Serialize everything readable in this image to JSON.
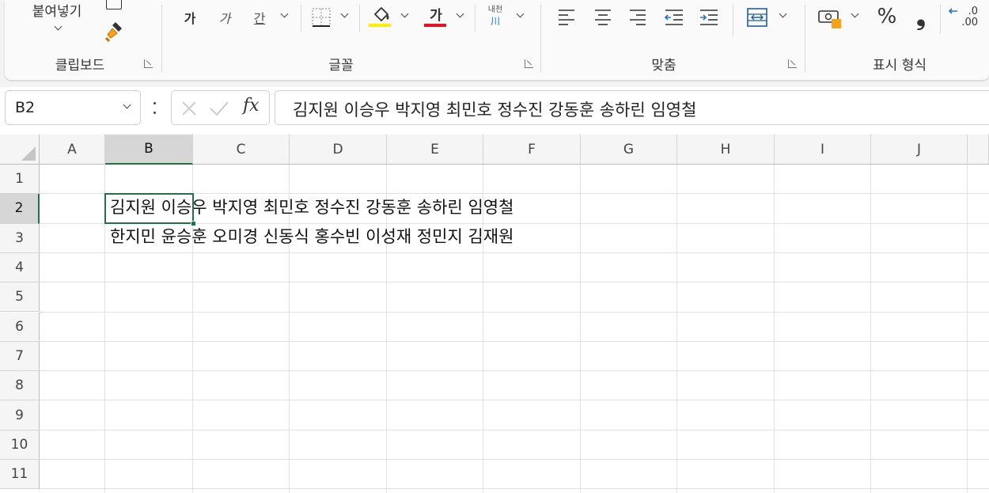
{
  "ribbon": {
    "clipboard": {
      "paste_label": "붙여넣기",
      "copy_label": "복사",
      "group_label": "클립보드"
    },
    "font": {
      "bold_label": "가",
      "italic_label": "가",
      "underline_label": "간",
      "font_color_label": "가",
      "phonetic_label": "내천",
      "fill_color": "#ffee00",
      "font_color": "#e81123",
      "group_label": "글꼴"
    },
    "alignment": {
      "group_label": "맞춤"
    },
    "number": {
      "percent_label": "%",
      "comma_label": "❟",
      "increase_decimal_label": ".0",
      "increase_decimal_label2": ".00",
      "group_label": "표시 형식"
    }
  },
  "formula_bar": {
    "name_box": "B2",
    "fx_label": "fx",
    "content": "김지원 이승우 박지영 최민호 정수진 강동훈 송하린 임영철"
  },
  "sheet": {
    "columns": [
      "A",
      "B",
      "C",
      "D",
      "E",
      "F",
      "G",
      "H",
      "I",
      "J"
    ],
    "rows": [
      "1",
      "2",
      "3",
      "4",
      "5",
      "6",
      "7",
      "8",
      "9",
      "10",
      "11"
    ],
    "selected_cell": "B2",
    "selected_column": "B",
    "selected_row": "2",
    "cells": {
      "B2": "김지원 이승우 박지영 최민호 정수진 강동훈 송하린 임영철",
      "B3": "한지민 윤승훈 오미경 신동식 홍수빈 이성재 정민지 김재원"
    }
  },
  "colors": {
    "accent": "#217346",
    "header_bg": "#f5f5f5",
    "selected_header_bg": "#d6d6d6"
  }
}
